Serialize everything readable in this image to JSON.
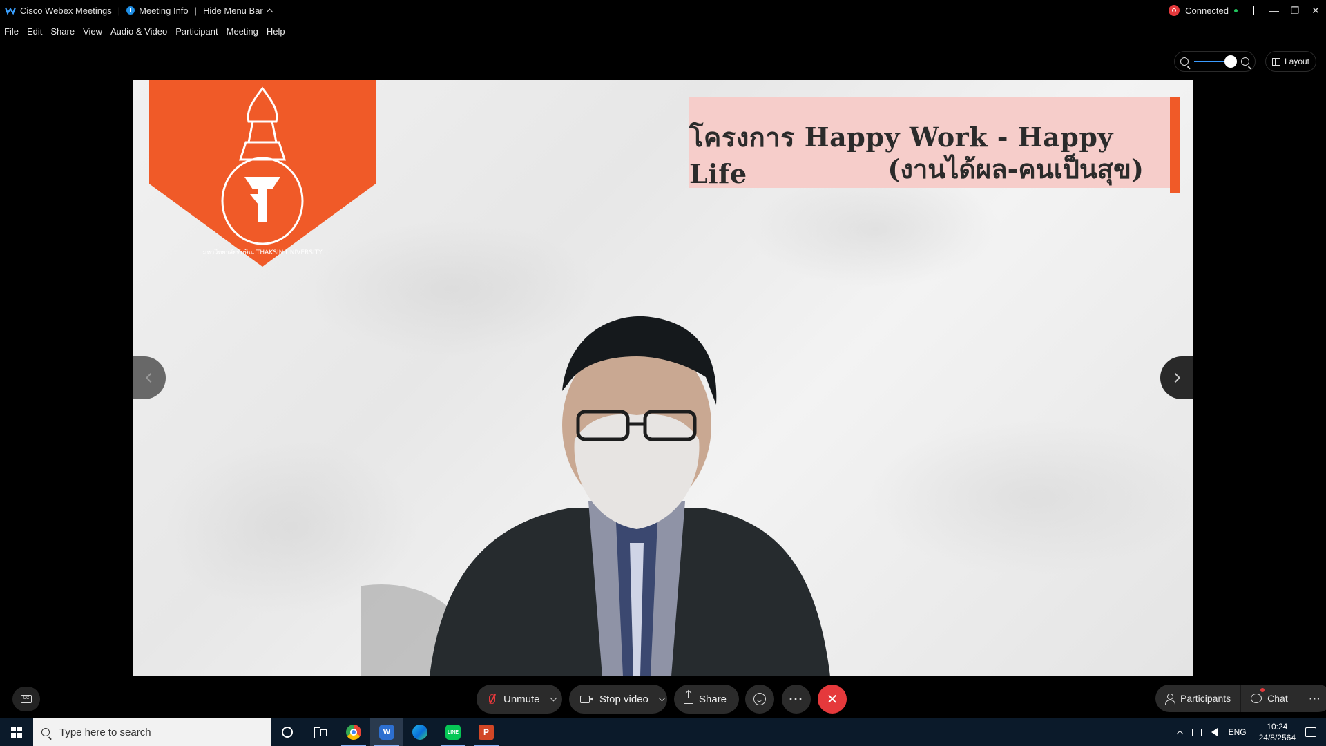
{
  "titlebar": {
    "app_name": "Cisco Webex Meetings",
    "meeting_info": "Meeting Info",
    "hide_menu": "Hide Menu Bar",
    "status": "Connected"
  },
  "menu": [
    "File",
    "Edit",
    "Share",
    "View",
    "Audio & Video",
    "Participant",
    "Meeting",
    "Help"
  ],
  "view_controls": {
    "layout_label": "Layout"
  },
  "slide": {
    "title_line1": "โครงการ Happy Work - Happy Life",
    "title_line2": "(งานได้ผล-คนเป็นสุข)",
    "logo_text": "มหาวิทยาลัยทักษิณ THAKSIN UNIVERSITY"
  },
  "controls": {
    "unmute": "Unmute",
    "stop_video": "Stop video",
    "share": "Share",
    "more": "···",
    "leave": "✕"
  },
  "panels": {
    "participants": "Participants",
    "chat": "Chat",
    "more": "···"
  },
  "taskbar": {
    "search_placeholder": "Type here to search",
    "language": "ENG",
    "time": "10:24",
    "date": "24/8/2564"
  },
  "colors": {
    "accent_orange": "#f05a28",
    "title_card_pink": "#f6cdca",
    "leave_red": "#e5393c",
    "webex_blue": "#2d6fd0"
  }
}
